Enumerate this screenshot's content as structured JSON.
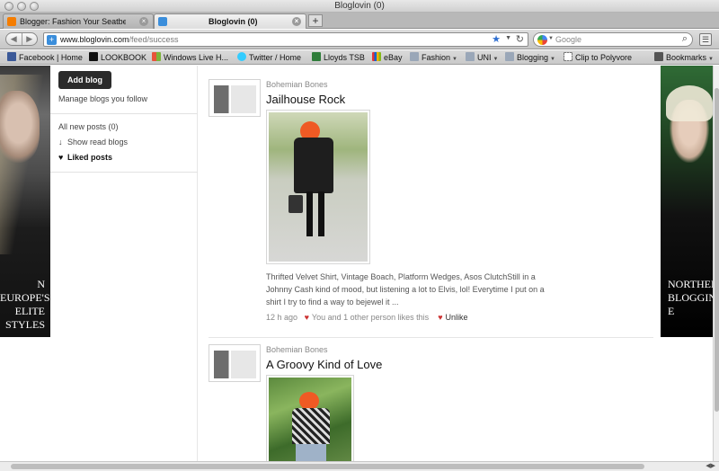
{
  "window": {
    "title": "Bloglovin (0)"
  },
  "tabs": [
    {
      "label": "Blogger: Fashion Your Seatbelts...",
      "active": false
    },
    {
      "label": "Bloglovin (0)",
      "active": true
    }
  ],
  "newtab_glyph": "+",
  "navbar": {
    "url_host": "www.bloglovin.com",
    "url_path": "/feed/success",
    "search_placeholder": "Google"
  },
  "bookmarks": [
    {
      "label": "Facebook | Home",
      "icon": "facebook-icon",
      "color": "#3b5998"
    },
    {
      "label": "LOOKBOOK",
      "icon": "lookbook-icon",
      "color": "#111111"
    },
    {
      "label": "Windows Live H...",
      "icon": "windows-icon",
      "color": "#e8a23a"
    },
    {
      "label": "Twitter / Home",
      "icon": "twitter-icon",
      "color": "#33ccff"
    },
    {
      "label": "Lloyds TSB",
      "icon": "lloyds-icon",
      "color": "#2f7d3a"
    },
    {
      "label": "eBay",
      "icon": "ebay-icon",
      "color": "#e53238"
    },
    {
      "label": "Fashion",
      "icon": "folder-icon",
      "color": "#9aa7b8",
      "menu": true
    },
    {
      "label": "UNI",
      "icon": "folder-icon",
      "color": "#9aa7b8",
      "menu": true
    },
    {
      "label": "Blogging",
      "icon": "folder-icon",
      "color": "#9aa7b8",
      "menu": true
    },
    {
      "label": "Clip to Polyvore",
      "icon": "clip-icon",
      "color": "#ffffff"
    },
    {
      "label": "Bookmarks",
      "icon": "bookmarks-icon",
      "color": "#555555",
      "menu": true
    }
  ],
  "ads": {
    "left_text": "N EUROPE'S ELITE STYLES",
    "right_text": "NORTHERN BLOGGING E"
  },
  "sidebar": {
    "add_blog": "Add blog",
    "manage": "Manage blogs you follow",
    "all_new": "All new posts (0)",
    "show_read": "Show read blogs",
    "show_read_glyph": "↓",
    "liked": "Liked posts",
    "liked_glyph": "♥"
  },
  "posts": [
    {
      "author": "Bohemian Bones",
      "title": "Jailhouse Rock",
      "excerpt": "Thrifted Velvet Shirt, Vintage Boach, Platform Wedges, Asos ClutchStill in a Johnny Cash kind of mood, but listening a lot to Elvis, lol! Everytime I put on a shirt I try to find a way to bejewel it ...",
      "time": "12 h ago",
      "likes": "You and 1 other person likes this",
      "unlike": "Unlike"
    },
    {
      "author": "Bohemian Bones",
      "title": "A Groovy Kind of Love"
    }
  ],
  "glyphs": {
    "heart": "♥",
    "back": "◀",
    "forward": "▶",
    "star": "★",
    "reload": "↻",
    "search": "⌕",
    "dropdown": "▼",
    "close": "×"
  }
}
